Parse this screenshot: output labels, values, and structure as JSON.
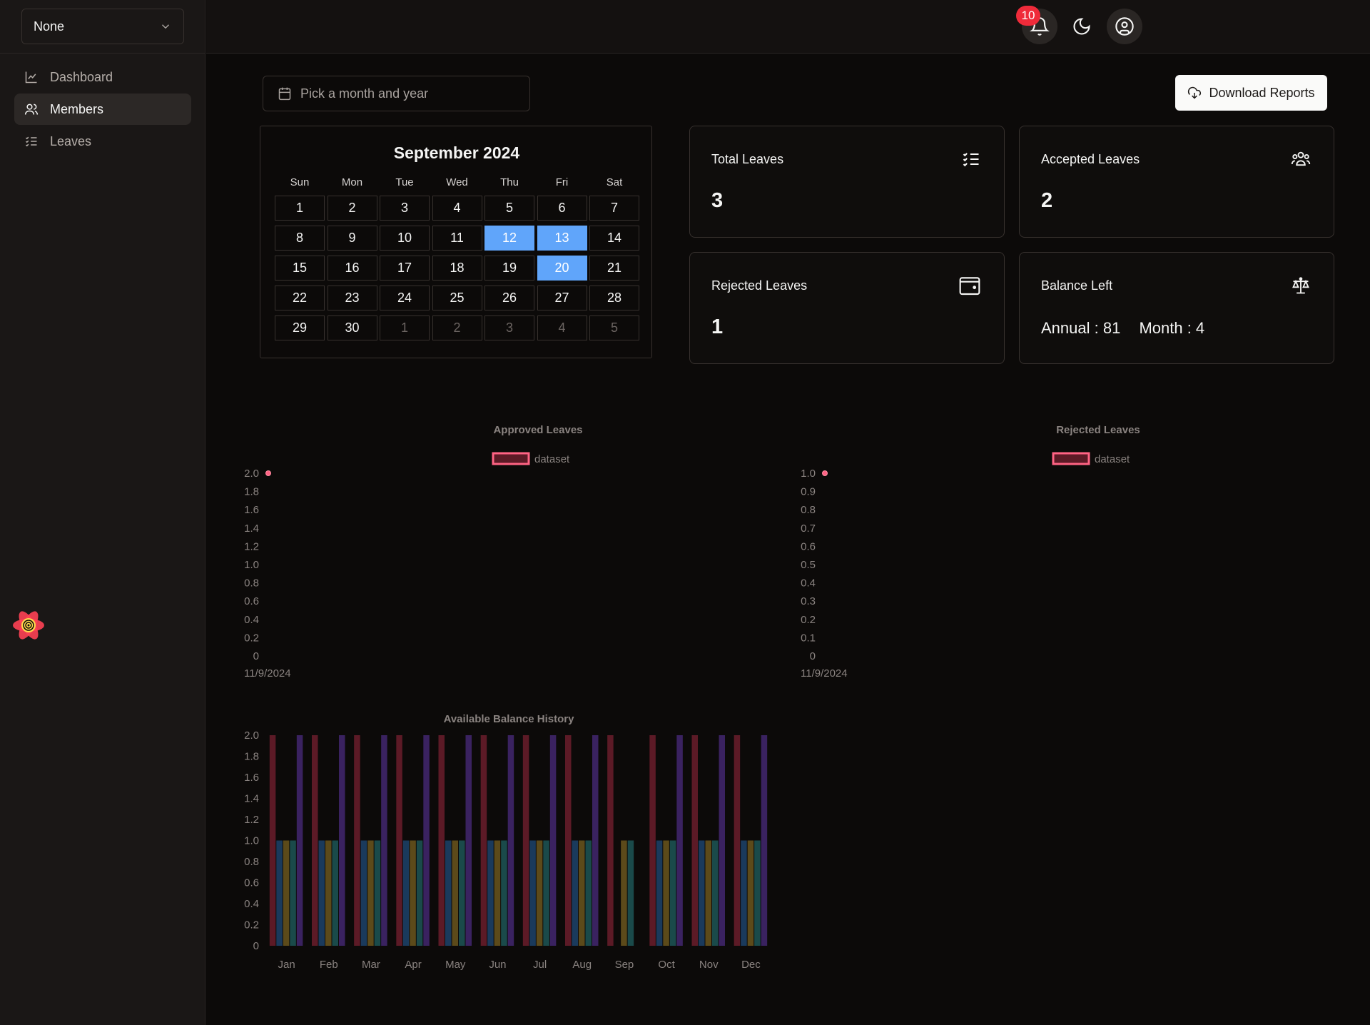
{
  "sidebar": {
    "team_select": "None",
    "nav": [
      {
        "label": "Dashboard",
        "icon": "chart-line-icon"
      },
      {
        "label": "Members",
        "icon": "users-icon",
        "active": true
      },
      {
        "label": "Leaves",
        "icon": "list-checks-icon"
      }
    ]
  },
  "header": {
    "notification_count": "10"
  },
  "toolbar": {
    "date_placeholder": "Pick a month and year",
    "download_label": "Download Reports"
  },
  "calendar": {
    "title": "September 2024",
    "weekdays": [
      "Sun",
      "Mon",
      "Tue",
      "Wed",
      "Thu",
      "Fri",
      "Sat"
    ],
    "days": [
      "1",
      "2",
      "3",
      "4",
      "5",
      "6",
      "7",
      "8",
      "9",
      "10",
      "11",
      "12",
      "13",
      "14",
      "15",
      "16",
      "17",
      "18",
      "19",
      "20",
      "21",
      "22",
      "23",
      "24",
      "25",
      "26",
      "27",
      "28",
      "29",
      "30",
      "1",
      "2",
      "3",
      "4",
      "5"
    ],
    "outside_days_start_index": 30,
    "selected_days": [
      "12",
      "13",
      "20"
    ],
    "selected_color": "#60a5fa"
  },
  "stats": {
    "total": {
      "label": "Total Leaves",
      "value": "3"
    },
    "accepted": {
      "label": "Accepted Leaves",
      "value": "2"
    },
    "rejected": {
      "label": "Rejected Leaves",
      "value": "1"
    },
    "balance": {
      "label": "Balance Left",
      "annual": "Annual : 81",
      "month": "Month : 4"
    }
  },
  "chart_data": [
    {
      "type": "scatter",
      "title": "Approved Leaves",
      "legend": [
        "dataset"
      ],
      "x": [
        "11/9/2024"
      ],
      "series": [
        {
          "name": "dataset",
          "values": [
            2
          ],
          "color": "#ff6384"
        }
      ],
      "ylim": [
        0,
        2
      ],
      "yticks": [
        "2.0",
        "1.8",
        "1.6",
        "1.4",
        "1.2",
        "1.0",
        "0.8",
        "0.6",
        "0.4",
        "0.2",
        "0"
      ]
    },
    {
      "type": "scatter",
      "title": "Rejected Leaves",
      "legend": [
        "dataset"
      ],
      "x": [
        "11/9/2024"
      ],
      "series": [
        {
          "name": "dataset",
          "values": [
            1
          ],
          "color": "#ff6384"
        }
      ],
      "ylim": [
        0,
        1
      ],
      "yticks": [
        "1.0",
        "0.9",
        "0.8",
        "0.7",
        "0.6",
        "0.5",
        "0.4",
        "0.3",
        "0.2",
        "0.1",
        "0"
      ]
    },
    {
      "type": "bar",
      "title": "Available Balance History",
      "categories": [
        "Jan",
        "Feb",
        "Mar",
        "Apr",
        "May",
        "Jun",
        "Jul",
        "Aug",
        "Sep",
        "Oct",
        "Nov",
        "Dec"
      ],
      "ylim": [
        0,
        2
      ],
      "yticks": [
        "2.0",
        "1.8",
        "1.6",
        "1.4",
        "1.2",
        "1.0",
        "0.8",
        "0.6",
        "0.4",
        "0.2",
        "0"
      ],
      "series": [
        {
          "values": [
            2,
            2,
            2,
            2,
            2,
            2,
            2,
            2,
            2,
            2,
            2,
            2
          ],
          "color": "#5c1a26"
        },
        {
          "values": [
            1,
            1,
            1,
            1,
            1,
            1,
            1,
            1,
            0,
            1,
            1,
            1
          ],
          "color": "#1a3a5c"
        },
        {
          "values": [
            1,
            1,
            1,
            1,
            1,
            1,
            1,
            1,
            1,
            1,
            1,
            1
          ],
          "color": "#5c4a1a"
        },
        {
          "values": [
            1,
            1,
            1,
            1,
            1,
            1,
            1,
            1,
            1,
            1,
            1,
            1
          ],
          "color": "#1a4a4a"
        },
        {
          "values": [
            2,
            2,
            2,
            2,
            2,
            2,
            2,
            2,
            0,
            2,
            2,
            2
          ],
          "color": "#3a2260"
        }
      ]
    }
  ]
}
